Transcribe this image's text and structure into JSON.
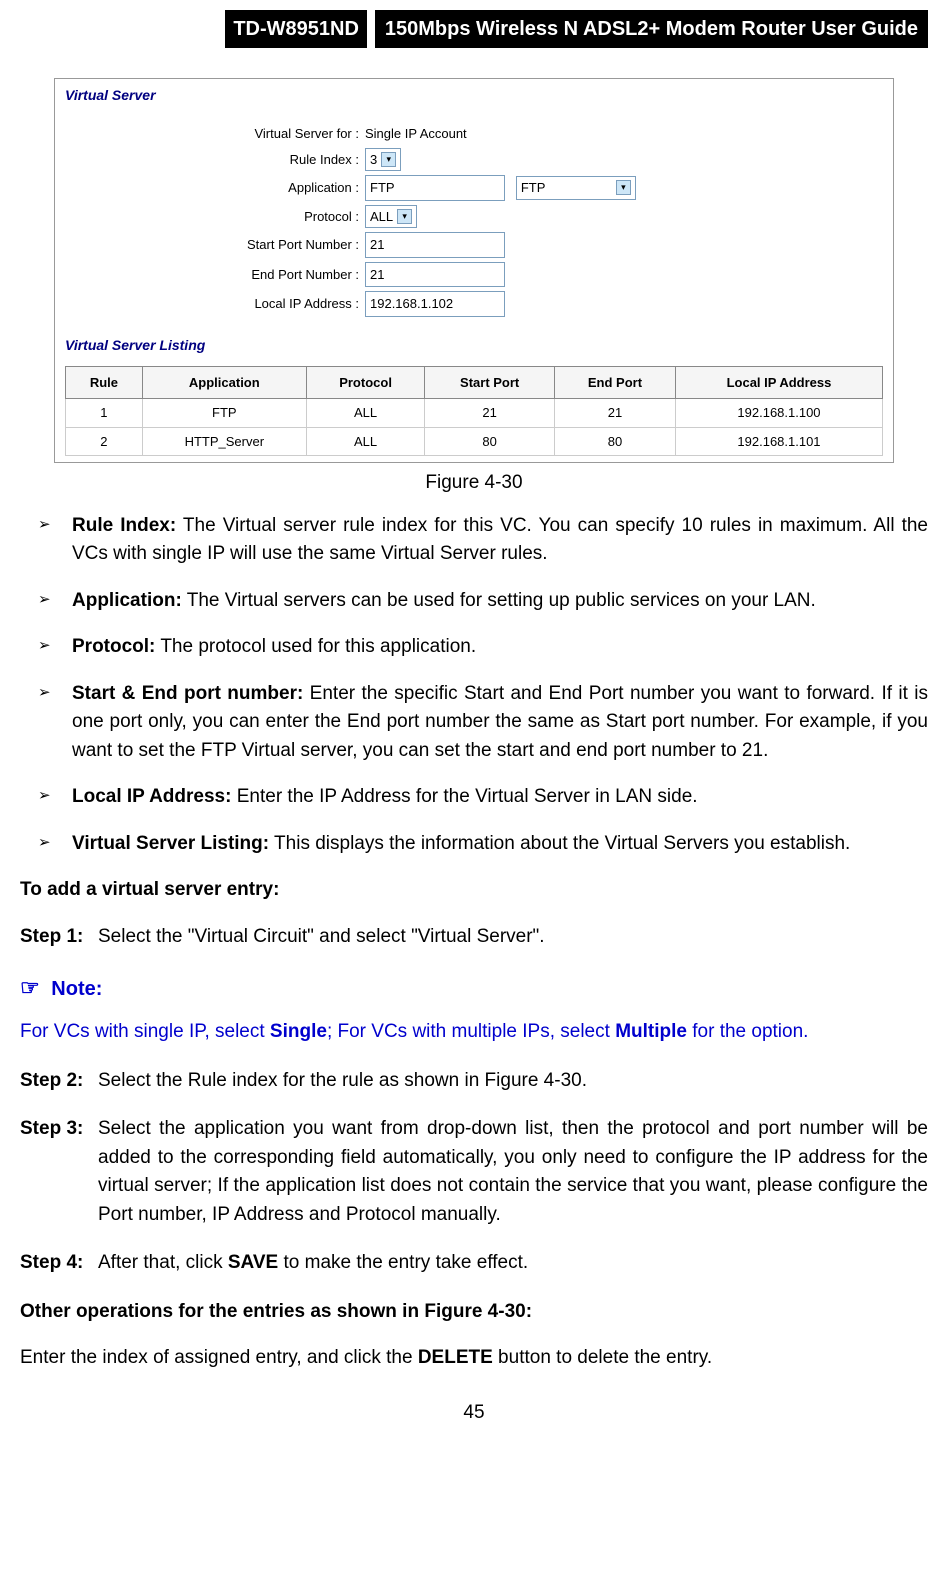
{
  "header": {
    "model": "TD-W8951ND",
    "title": "150Mbps Wireless N ADSL2+ Modem Router User Guide"
  },
  "screenshot": {
    "section_vs": "Virtual Server",
    "section_listing": "Virtual Server Listing",
    "fields": {
      "vs_for_label": "Virtual Server for :",
      "vs_for_value": "Single IP Account",
      "rule_index_label": "Rule Index :",
      "rule_index_value": "3",
      "application_label": "Application :",
      "application_value": "FTP",
      "application_preset": "FTP",
      "protocol_label": "Protocol :",
      "protocol_value": "ALL",
      "start_port_label": "Start Port Number :",
      "start_port_value": "21",
      "end_port_label": "End Port Number :",
      "end_port_value": "21",
      "local_ip_label": "Local IP Address :",
      "local_ip_value": "192.168.1.102"
    },
    "table": {
      "cols": [
        "Rule",
        "Application",
        "Protocol",
        "Start Port",
        "End Port",
        "Local IP Address"
      ],
      "rows": [
        [
          "1",
          "FTP",
          "ALL",
          "21",
          "21",
          "192.168.1.100"
        ],
        [
          "2",
          "HTTP_Server",
          "ALL",
          "80",
          "80",
          "192.168.1.101"
        ]
      ]
    }
  },
  "figure_caption": "Figure 4-30",
  "bullets": [
    {
      "term": "Rule Index:",
      "text": " The Virtual server rule index for this VC. You can specify 10 rules in maximum. All the VCs with single IP will use the same Virtual Server rules."
    },
    {
      "term": "Application:",
      "text": " The Virtual servers can be used for setting up public services on your LAN."
    },
    {
      "term": "Protocol:",
      "text": " The protocol used for this application."
    },
    {
      "term": "Start & End port number:",
      "text": " Enter the specific Start and End Port number you want to forward. If it is one port only, you can enter the End port number the same as Start port number. For example, if you want to set the FTP Virtual server, you can set the start and end port number to 21."
    },
    {
      "term": "Local IP Address:",
      "text": " Enter the IP Address for the Virtual Server in LAN side."
    },
    {
      "term": "Virtual Server Listing:",
      "text": " This displays the information about the Virtual Servers you establish."
    }
  ],
  "heading_add": "To add a virtual server entry:",
  "step1_label": "Step 1:",
  "step1_text": "Select the \"Virtual Circuit\" and select \"Virtual Server\".",
  "note_title": "Note:",
  "note_pre1": "For VCs with single IP, select ",
  "note_b1": "Single",
  "note_mid": "; For VCs with multiple IPs, select ",
  "note_b2": "Multiple",
  "note_post": " for the option.",
  "step2_label": "Step 2:",
  "step2_text": "Select the Rule index for the rule as shown in Figure 4-30.",
  "step3_label": "Step 3:",
  "step3_text": "Select the application you want from drop-down list, then the protocol and port number will be added to the corresponding field automatically, you only need to configure the IP address for the virtual server; If the application list does not contain the service that you want, please configure the Port number, IP Address and Protocol manually.",
  "step4_label": "Step 4:",
  "step4_pre": "After that, click ",
  "step4_b": "SAVE",
  "step4_post": " to make the entry take effect.",
  "heading_other": "Other operations for the entries as shown in Figure 4-30:",
  "other_pre": "Enter the index of assigned entry, and click the ",
  "other_b": "DELETE",
  "other_post": " button to delete the entry.",
  "page_number": "45"
}
